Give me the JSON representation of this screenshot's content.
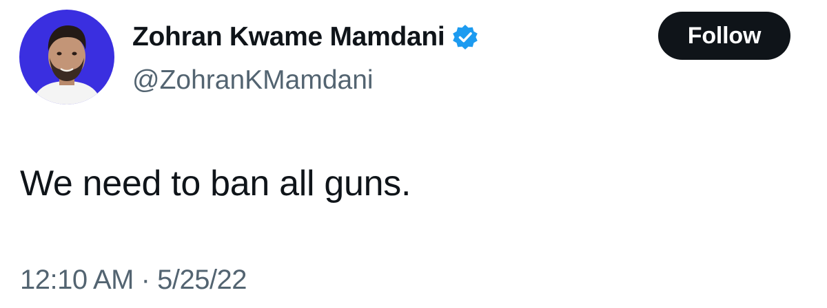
{
  "tweet": {
    "author": {
      "display_name": "Zohran Kwame Mamdani",
      "handle": "@ZohranKMamdani",
      "verified_icon": "verified-badge-icon",
      "avatar_background": "#3a2fe0"
    },
    "follow_label": "Follow",
    "text": "We need to ban all guns.",
    "time": "12:10 AM",
    "separator": "·",
    "date": "5/25/22"
  },
  "colors": {
    "primary_text": "#0f1419",
    "secondary_text": "#536471",
    "verified_blue": "#1d9bf0",
    "button_bg": "#0f1419"
  }
}
